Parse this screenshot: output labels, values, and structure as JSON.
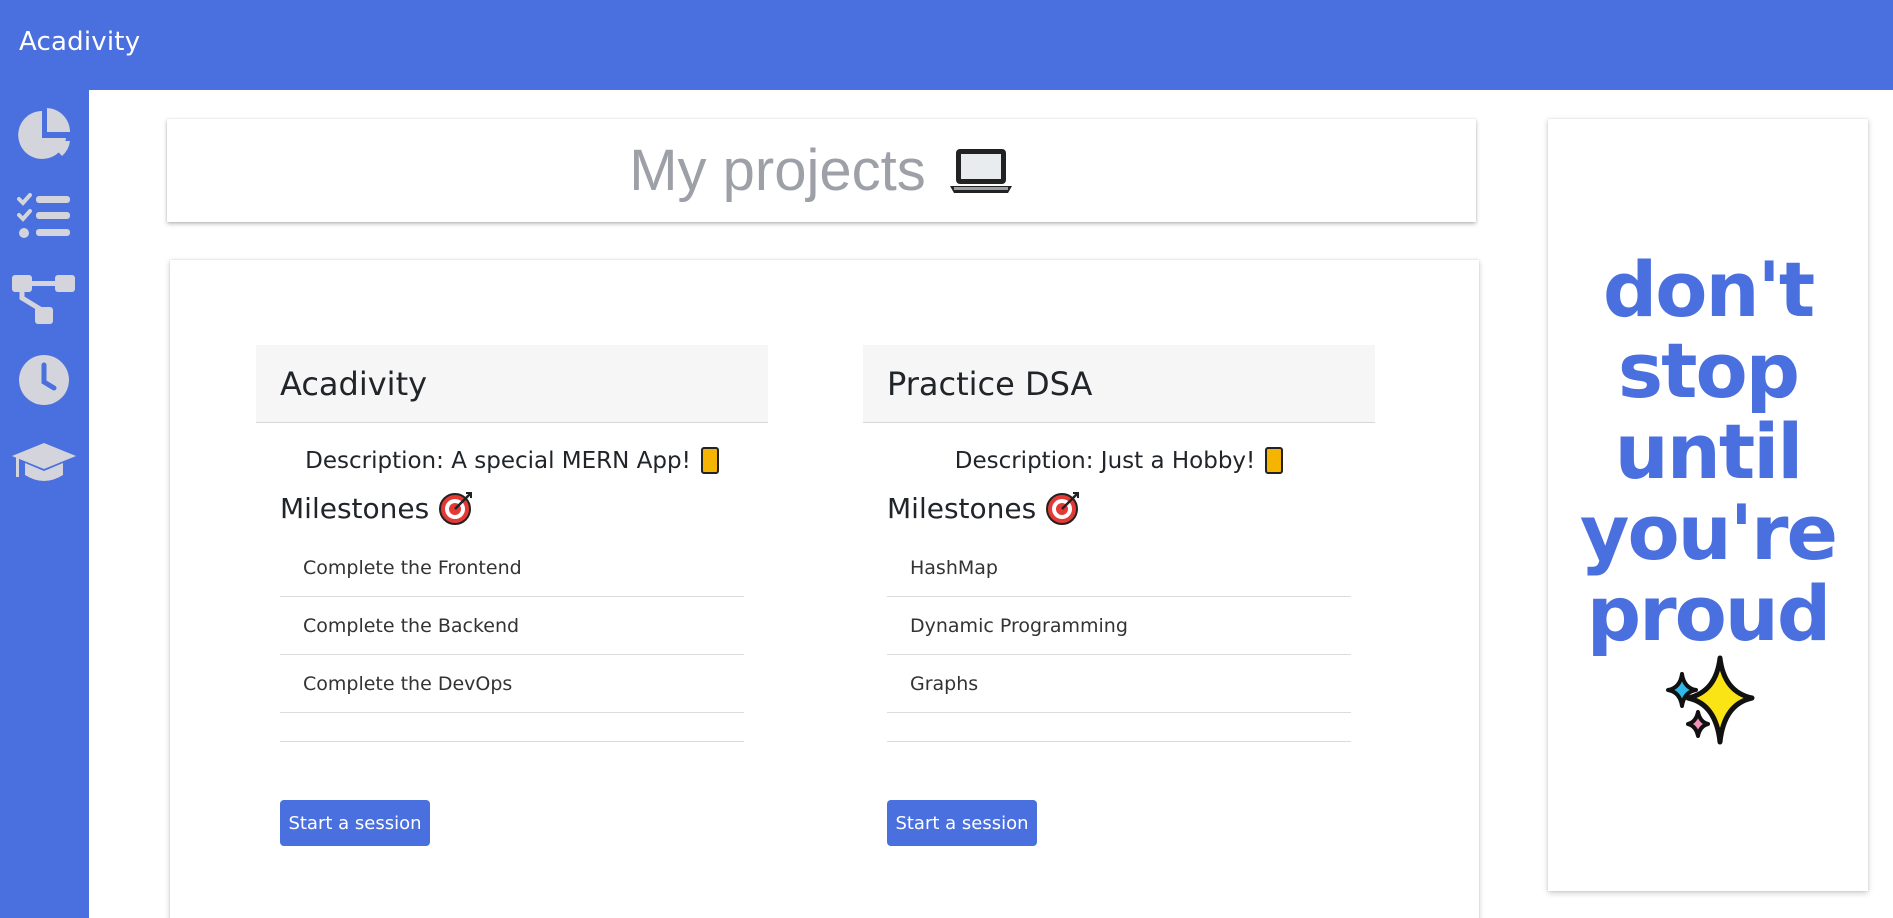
{
  "app": {
    "title": "Acadivity"
  },
  "sidebar": {
    "items": [
      {
        "icon": "pie-chart-icon"
      },
      {
        "icon": "checklist-icon"
      },
      {
        "icon": "hierarchy-icon"
      },
      {
        "icon": "clock-icon"
      },
      {
        "icon": "graduation-cap-icon"
      }
    ]
  },
  "page": {
    "title": "My projects",
    "title_icon": "laptop-icon"
  },
  "projects": [
    {
      "name": "Acadivity",
      "description": "Description: A special MERN App!",
      "milestones_title": "Milestones",
      "milestones": [
        "Complete the Frontend",
        "Complete the Backend",
        "Complete the DevOps"
      ],
      "button_label": "Start a session"
    },
    {
      "name": "Practice DSA",
      "description": "Description: Just a Hobby!",
      "milestones_title": "Milestones",
      "milestones": [
        "HashMap",
        "Dynamic Programming",
        "Graphs"
      ],
      "button_label": "Start a session"
    }
  ],
  "quote": {
    "lines": [
      "don't",
      "stop",
      "until",
      "you're",
      "proud"
    ]
  },
  "colors": {
    "accent": "#4a6fde",
    "sidebar_icon": "#d3d4dc",
    "title_text": "#9ea0a8"
  }
}
